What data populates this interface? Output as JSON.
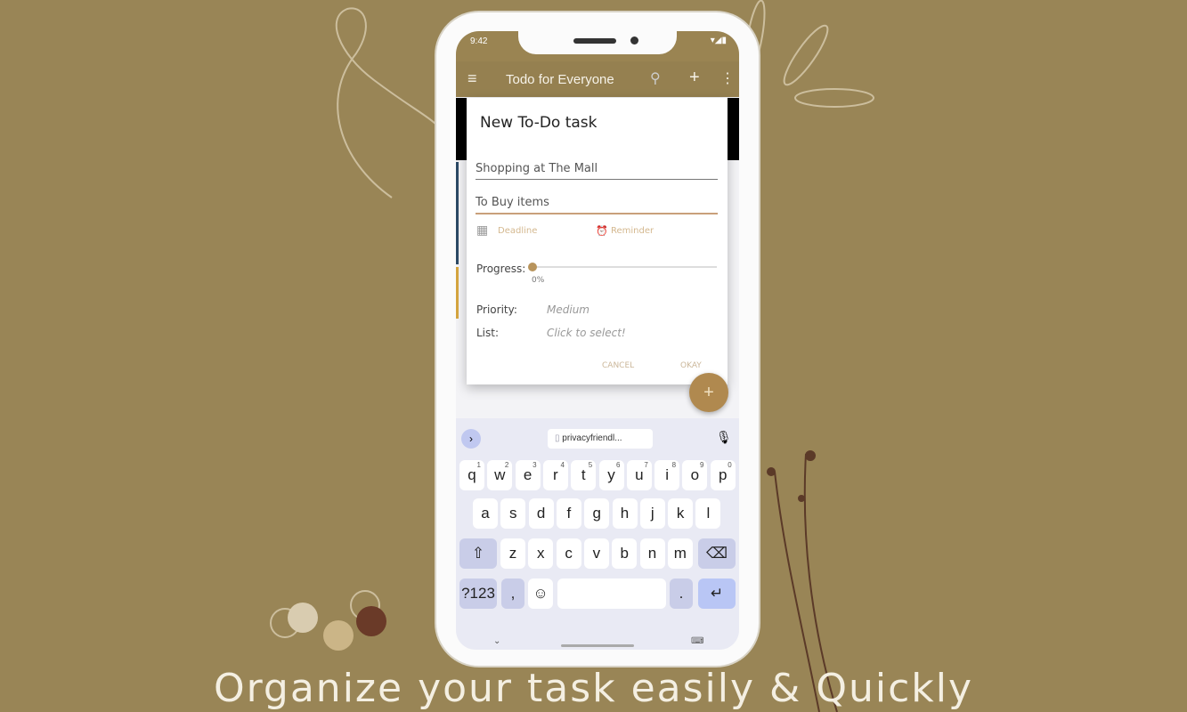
{
  "status": {
    "time": "9:42"
  },
  "appbar": {
    "title": "Todo for Everyone"
  },
  "dialog": {
    "title": "New To-Do task",
    "task_name": "Shopping at The Mall",
    "description": "To Buy items",
    "deadline": "Deadline",
    "reminder": "Reminder",
    "progress_label": "Progress:",
    "progress_value": "0%",
    "progress": 0,
    "priority_label": "Priority:",
    "priority_value": "Medium",
    "list_label": "List:",
    "list_value": "Click to select!",
    "cancel": "CANCEL",
    "okay": "OKAY"
  },
  "keyboard": {
    "suggestion": "privacyfriendl...",
    "row1": [
      [
        "q",
        "1"
      ],
      [
        "w",
        "2"
      ],
      [
        "e",
        "3"
      ],
      [
        "r",
        "4"
      ],
      [
        "t",
        "5"
      ],
      [
        "y",
        "6"
      ],
      [
        "u",
        "7"
      ],
      [
        "i",
        "8"
      ],
      [
        "o",
        "9"
      ],
      [
        "p",
        "0"
      ]
    ],
    "row2": [
      "a",
      "s",
      "d",
      "f",
      "g",
      "h",
      "j",
      "k",
      "l"
    ],
    "row3": [
      "z",
      "x",
      "c",
      "v",
      "b",
      "n",
      "m"
    ],
    "symbols": "?123",
    "comma": ",",
    "period": "."
  },
  "caption": "Organize your task easily & Quickly",
  "colors": {
    "background": "#998556",
    "appbar": "#958050",
    "accent": "#b8945c"
  }
}
